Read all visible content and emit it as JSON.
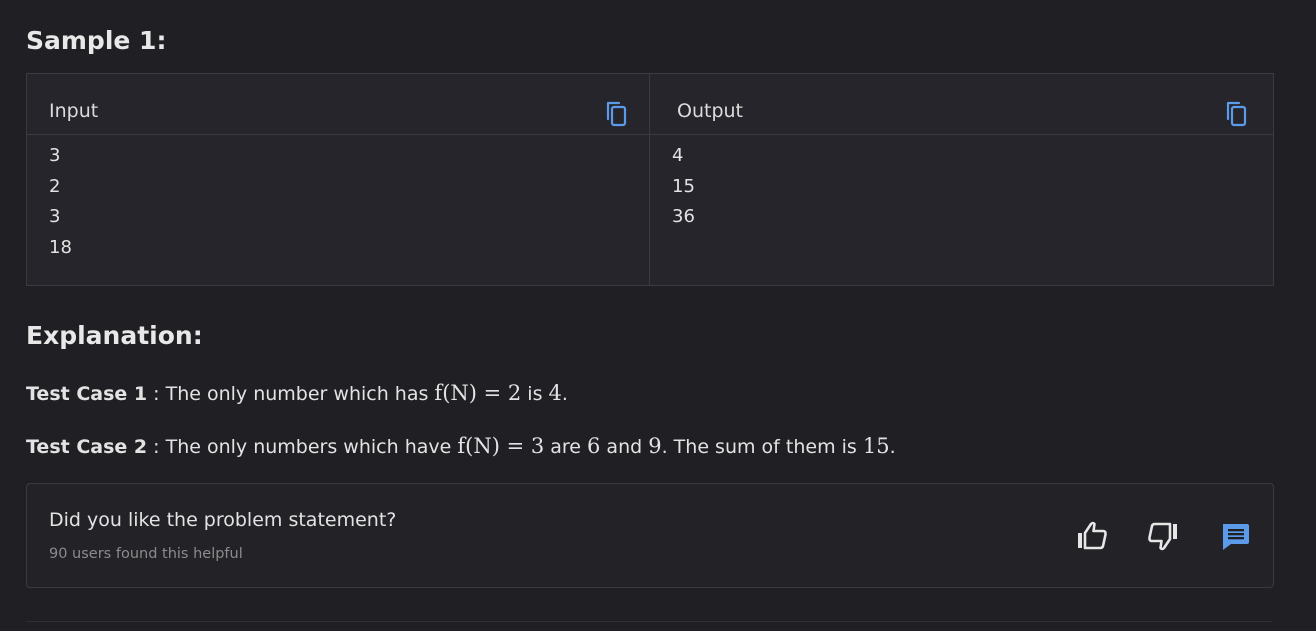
{
  "sample": {
    "title": "Sample 1:",
    "input_label": "Input",
    "output_label": "Output",
    "input_lines": [
      "3",
      "2",
      "3",
      "18"
    ],
    "output_lines": [
      "4",
      "15",
      "36"
    ]
  },
  "explanation": {
    "title": "Explanation:",
    "cases": [
      {
        "label": "Test Case 1",
        "sep": " : ",
        "text_a": "The only number which has ",
        "math_a": "f(N) = 2",
        "text_b": " is ",
        "math_b": "4",
        "text_c": "."
      },
      {
        "label": "Test Case 2",
        "sep": " : ",
        "text_a": "The only numbers which have ",
        "math_a": "f(N) = 3",
        "text_b": " are ",
        "math_b": "6",
        "text_c": " and ",
        "math_c": "9",
        "text_d": ". The sum of them is ",
        "math_d": "15",
        "text_e": "."
      }
    ]
  },
  "feedback": {
    "question": "Did you like the problem statement?",
    "helpful_count": "90 users found this helpful"
  },
  "icons": {
    "copy": "copy-icon",
    "like": "thumbs-up-icon",
    "dislike": "thumbs-down-icon",
    "comment": "comment-icon"
  },
  "colors": {
    "accent": "#5b9bea",
    "background": "#202024",
    "panel": "#25252b"
  }
}
